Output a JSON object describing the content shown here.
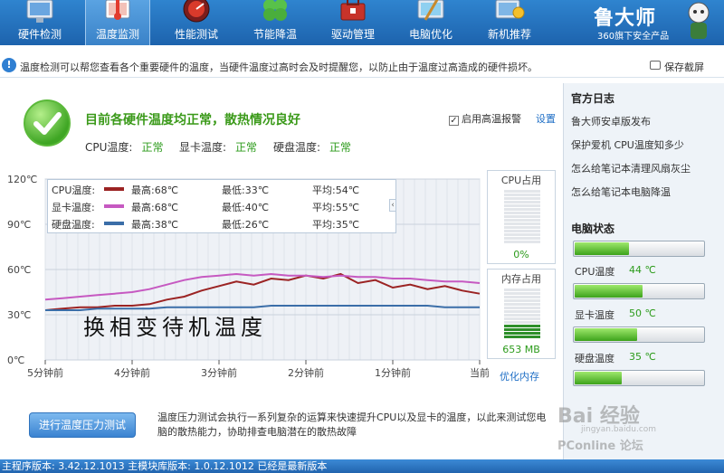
{
  "nav": {
    "tabs": [
      {
        "label": "硬件检测",
        "icon": "monitor-icon"
      },
      {
        "label": "温度监测",
        "icon": "thermometer-icon",
        "active": true
      },
      {
        "label": "性能测试",
        "icon": "speedometer-icon"
      },
      {
        "label": "节能降温",
        "icon": "clover-icon"
      },
      {
        "label": "驱动管理",
        "icon": "toolbox-icon"
      },
      {
        "label": "电脑优化",
        "icon": "broom-monitor-icon"
      },
      {
        "label": "新机推荐",
        "icon": "award-monitor-icon"
      }
    ],
    "brand_name": "鲁大师",
    "brand_sub": "360旗下安全产品"
  },
  "infobar": {
    "message": "温度检测可以帮您查看各个重要硬件的温度，当硬件温度过高时会及时提醒您，以防止由于温度过高造成的硬件损坏。",
    "snapshot_label": "保存截屏"
  },
  "status": {
    "headline": "目前各硬件温度均正常，散热情况良好",
    "items": [
      {
        "label": "CPU温度:",
        "value": "正常"
      },
      {
        "label": "显卡温度:",
        "value": "正常"
      },
      {
        "label": "硬盘温度:",
        "value": "正常"
      }
    ],
    "alarm_label": "启用高温报警",
    "alarm_checked": "✓",
    "settings_label": "设置"
  },
  "legend": [
    {
      "name": "CPU温度:",
      "max": "最高:68℃",
      "min": "最低:33℃",
      "avg": "平均:54℃",
      "color": "#9b2323"
    },
    {
      "name": "显卡温度:",
      "max": "最高:68℃",
      "min": "最低:40℃",
      "avg": "平均:55℃",
      "color": "#c659c1"
    },
    {
      "name": "硬盘温度:",
      "max": "最高:38℃",
      "min": "最低:26℃",
      "avg": "平均:35℃",
      "color": "#3b6ea8"
    }
  ],
  "chart_data": {
    "type": "line",
    "y_ticks": [
      "120℃",
      "90℃",
      "60℃",
      "30℃",
      "0℃"
    ],
    "x_ticks": [
      "5分钟前",
      "4分钟前",
      "3分钟前",
      "2分钟前",
      "1分钟前",
      "当前"
    ],
    "ylim": [
      0,
      120
    ],
    "grid": true,
    "annotation": "换相变待机温度",
    "x": [
      0,
      0.2,
      0.4,
      0.6,
      0.8,
      1.0,
      1.2,
      1.4,
      1.6,
      1.8,
      2.0,
      2.2,
      2.4,
      2.6,
      2.8,
      3.0,
      3.2,
      3.4,
      3.6,
      3.8,
      4.0,
      4.2,
      4.4,
      4.6,
      4.8,
      5.0
    ],
    "series": [
      {
        "name": "CPU温度:",
        "color": "#9b2323",
        "values": [
          33,
          34,
          35,
          35,
          36,
          36,
          37,
          40,
          42,
          46,
          49,
          52,
          50,
          54,
          53,
          56,
          54,
          57,
          51,
          53,
          48,
          50,
          47,
          49,
          46,
          44
        ]
      },
      {
        "name": "显卡温度:",
        "color": "#c659c1",
        "values": [
          40,
          41,
          42,
          43,
          44,
          45,
          47,
          50,
          53,
          55,
          56,
          57,
          56,
          57,
          56,
          56,
          55,
          56,
          55,
          55,
          54,
          54,
          53,
          52,
          52,
          51
        ]
      },
      {
        "name": "硬盘温度:",
        "color": "#3b6ea8",
        "values": [
          33,
          33,
          33,
          34,
          34,
          34,
          34,
          35,
          35,
          35,
          35,
          35,
          35,
          36,
          36,
          36,
          36,
          36,
          36,
          36,
          36,
          36,
          36,
          35,
          35,
          35
        ]
      }
    ]
  },
  "meters": {
    "cpu_title": "CPU占用",
    "cpu_value": "0%",
    "cpu_fraction": 0.0,
    "mem_title": "内存占用",
    "mem_value": "653 MB",
    "mem_fraction": 0.32,
    "optimize_label": "优化内存"
  },
  "stress": {
    "button_label": "进行温度压力测试",
    "description": "温度压力测试会执行一系列复杂的运算来快速提升CPU以及显卡的温度，以此来测试您电脑的散热能力，协助排查电脑潜在的散热故障"
  },
  "sidebar": {
    "news_title": "官方日志",
    "news": [
      "鲁大师安卓版发布",
      "保护爱机 CPU温度知多少",
      "怎么给笔记本清理风扇灰尘",
      "怎么给笔记本电脑降温"
    ],
    "status_title": "电脑状态",
    "bars": [
      {
        "fraction": 0.42
      },
      {
        "label": "CPU温度",
        "value": "44 ℃",
        "fraction": 0.52
      },
      {
        "label": "显卡温度",
        "value": "50 ℃",
        "fraction": 0.48
      },
      {
        "label": "硬盘温度",
        "value": "35 ℃",
        "fraction": 0.36
      }
    ]
  },
  "footer": {
    "text": "主程序版本: 3.42.12.1013   主模块库版本: 1.0.12.1012   已经是最新版本"
  },
  "watermark": {
    "text1": "Bai 经验",
    "text2": "jingyan.baidu.com",
    "text3": "PConline 论坛"
  }
}
